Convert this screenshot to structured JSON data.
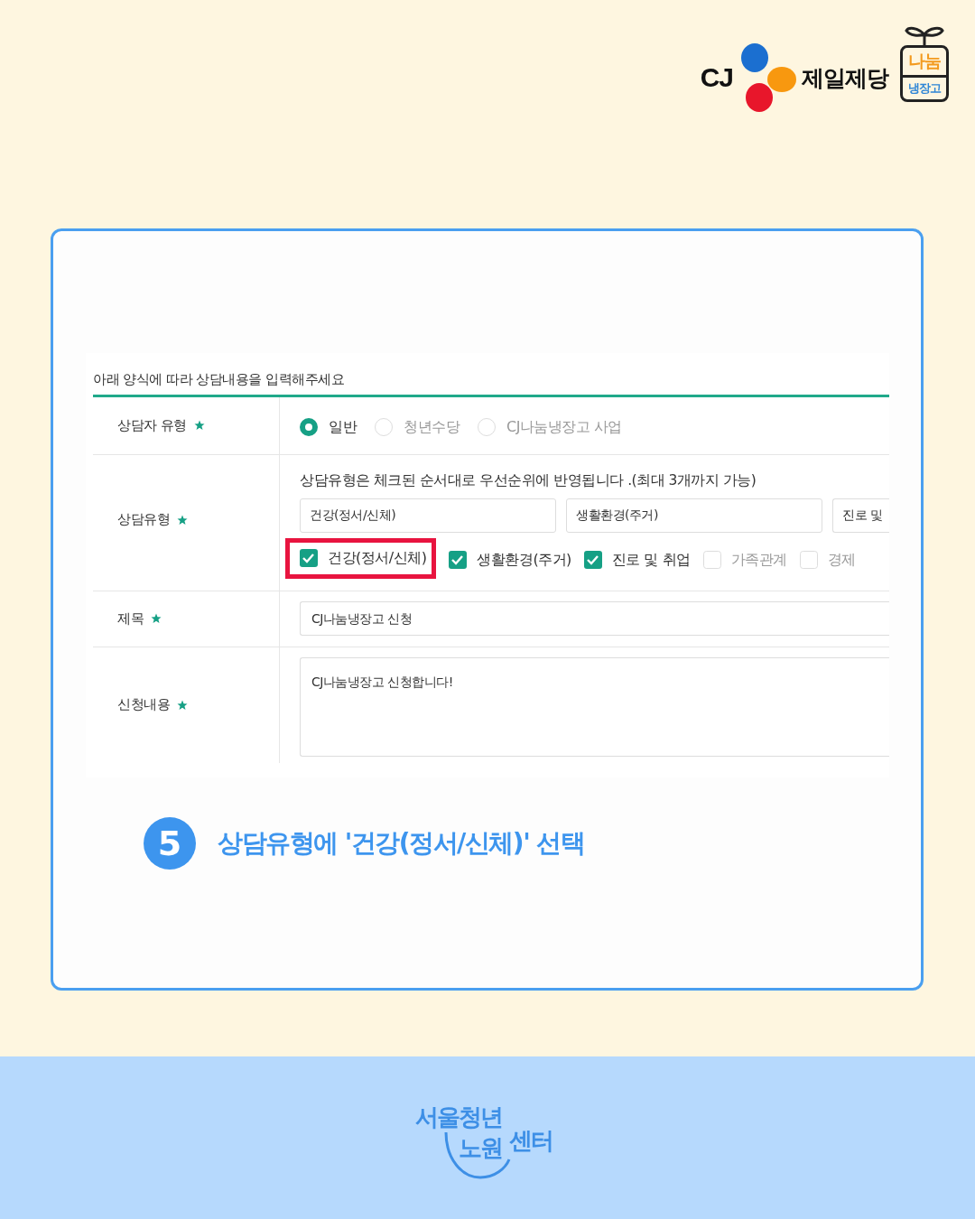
{
  "header": {
    "brand": {
      "mark": "CJ",
      "name": "제일제당"
    },
    "badge": {
      "top": "나눔",
      "bottom": "냉장고"
    }
  },
  "form": {
    "intro": "아래 양식에 따라 상담내용을 입력해주세요",
    "rows": [
      {
        "kind": "radio",
        "label": "상담자 유형",
        "required": true,
        "options": [
          {
            "label": "일반",
            "selected": true
          },
          {
            "label": "청년수당",
            "selected": false
          },
          {
            "label": "CJ나눔냉장고 사업",
            "selected": false
          }
        ]
      },
      {
        "kind": "checkboxes",
        "label": "상담유형",
        "required": true,
        "note": "상담유형은 체크된 순서대로 우선순위에 반영됩니다 .(최대 3개까지 가능)",
        "priorities": [
          "건강(정서/신체)",
          "생활환경(주거)",
          "진로 및"
        ],
        "options": [
          {
            "label": "건강(정서/신체)",
            "checked": true,
            "highlighted": true
          },
          {
            "label": "생활환경(주거)",
            "checked": true,
            "highlighted": false
          },
          {
            "label": "진로 및 취업",
            "checked": true,
            "highlighted": false
          },
          {
            "label": "가족관계",
            "checked": false,
            "highlighted": false
          },
          {
            "label": "경제",
            "checked": false,
            "highlighted": false
          }
        ]
      },
      {
        "kind": "input",
        "label": "제목",
        "required": true,
        "value": "CJ나눔냉장고 신청"
      },
      {
        "kind": "textarea",
        "label": "신청내용",
        "required": true,
        "value": "CJ나눔냉장고 신청합니다!"
      }
    ]
  },
  "step": {
    "number": "5",
    "caption": "상담유형에 '건강(정서/신체)' 선택"
  },
  "footer": {
    "logo": {
      "line1": "서울청년",
      "line2": "노원",
      "line3": "센터"
    }
  }
}
